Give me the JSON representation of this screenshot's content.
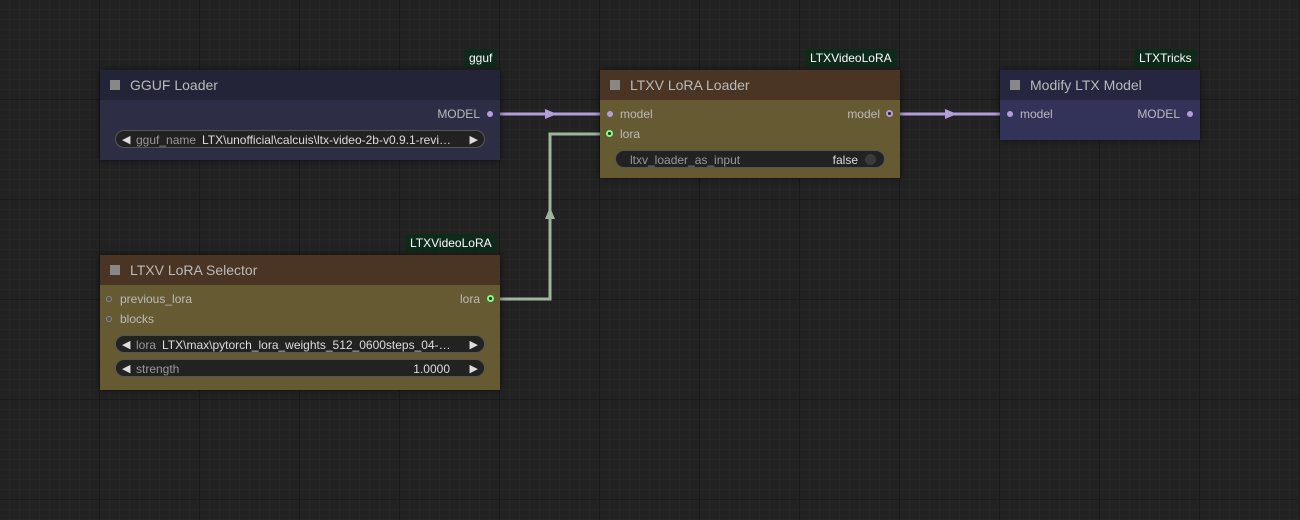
{
  "colors": {
    "background": "#222222",
    "model_link": "#b39ddb",
    "lora_link": "#9fb59f",
    "badge_bg": "#0d2a1a"
  },
  "nodes": {
    "gguf_loader": {
      "badge": "gguf",
      "title": "GGUF Loader",
      "output": "MODEL",
      "widget_label": "gguf_name",
      "widget_value": "LTX\\unofficial\\calcuis\\ltx-video-2b-v0.9.1-revi…"
    },
    "lora_loader": {
      "badge": "LTXVideoLoRA",
      "title": "LTXV LoRA Loader",
      "input_model": "model",
      "input_lora": "lora",
      "output": "model",
      "toggle_label": "ltxv_loader_as_input",
      "toggle_value": "false"
    },
    "modify_model": {
      "badge": "LTXTricks",
      "title": "Modify LTX Model",
      "input": "model",
      "output": "MODEL"
    },
    "lora_selector": {
      "badge": "LTXVideoLoRA",
      "title": "LTXV LoRA Selector",
      "input_prev": "previous_lora",
      "input_blocks": "blocks",
      "output": "lora",
      "lora_label": "lora",
      "lora_value": "LTX\\max\\pytorch_lora_weights_512_0600steps_04-…",
      "strength_label": "strength",
      "strength_value": "1.0000"
    }
  }
}
